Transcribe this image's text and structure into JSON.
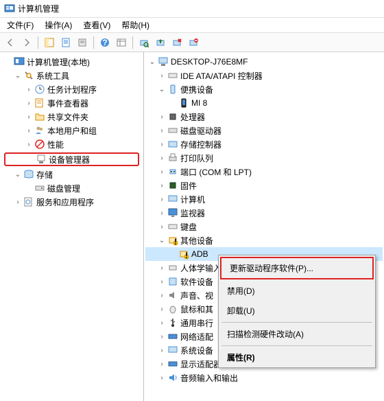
{
  "title": "计算机管理",
  "menubar": {
    "file": "文件(F)",
    "action": "操作(A)",
    "view": "查看(V)",
    "help": "帮助(H)"
  },
  "left_tree": {
    "root": "计算机管理(本地)",
    "system_tools": "系统工具",
    "task_scheduler": "任务计划程序",
    "event_viewer": "事件查看器",
    "shared_folders": "共享文件夹",
    "local_users": "本地用户和组",
    "performance": "性能",
    "device_manager": "设备管理器",
    "storage": "存储",
    "disk_management": "磁盘管理",
    "services_apps": "服务和应用程序"
  },
  "right_tree": {
    "root": "DESKTOP-J76E8MF",
    "ide": "IDE ATA/ATAPI 控制器",
    "portable": "便携设备",
    "mi8": "MI 8",
    "processors": "处理器",
    "disk_drives": "磁盘驱动器",
    "storage_controllers": "存储控制器",
    "print_queues": "打印队列",
    "ports": "端口 (COM 和 LPT)",
    "firmware": "固件",
    "computer": "计算机",
    "monitors": "监视器",
    "keyboards": "键盘",
    "other_devices": "其他设备",
    "adb": "ADB",
    "hid": "人体学输入",
    "software_devices": "软件设备",
    "sound_video": "声音、视",
    "mice": "鼠标和其",
    "usb": "通用串行",
    "network": "网络适配",
    "system_devices": "系统设备",
    "display_adapters": "显示适配器",
    "audio_io": "音频输入和输出"
  },
  "context_menu": {
    "update_driver": "更新驱动程序软件(P)...",
    "disable": "禁用(D)",
    "uninstall": "卸载(U)",
    "scan_hardware": "扫描检测硬件改动(A)",
    "properties": "属性(R)"
  }
}
